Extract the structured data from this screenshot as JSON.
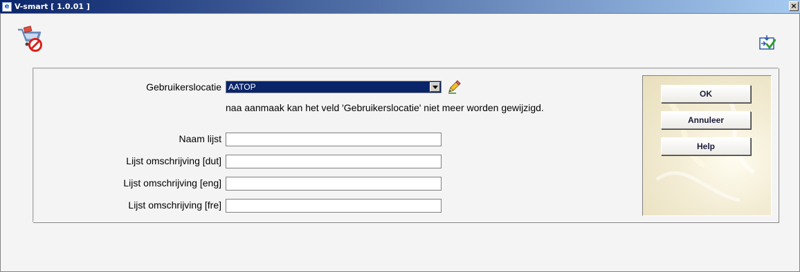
{
  "window": {
    "title": "V-smart [ 1.0.01 ]",
    "close_label": "×"
  },
  "icons": {
    "toolbar_left": "cart-delete-icon",
    "toolbar_right": "accept-arrow-icon",
    "edit": "pencil-icon",
    "dropdown": "chevron-down-icon"
  },
  "form": {
    "location_label": "Gebruikerslocatie",
    "location_value": "AATOP",
    "hint": "naa aanmaak kan het veld 'Gebruikerslocatie' niet meer worden gewijzigd.",
    "fields": [
      {
        "label": "Naam lijst",
        "value": ""
      },
      {
        "label": "Lijst omschrijving [dut]",
        "value": ""
      },
      {
        "label": "Lijst omschrijving [eng]",
        "value": ""
      },
      {
        "label": "Lijst omschrijving [fre]",
        "value": ""
      }
    ]
  },
  "buttons": {
    "ok": "OK",
    "cancel": "Annuleer",
    "help": "Help"
  },
  "colors": {
    "selection": "#0a246a",
    "titlebar_start": "#0a246a",
    "titlebar_end": "#a6caf0"
  }
}
